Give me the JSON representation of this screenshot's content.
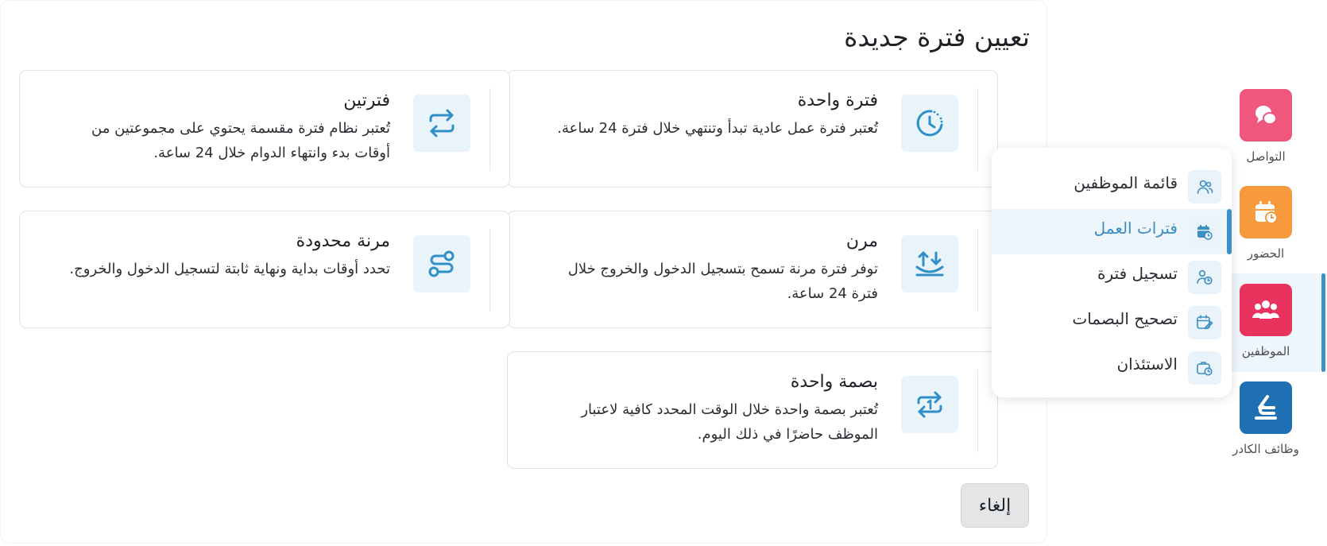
{
  "modal": {
    "title": "تعيين فترة جديدة",
    "cancel_label": "إلغاء",
    "cards": [
      {
        "title": "فترة واحدة",
        "desc": "تُعتبر فترة عمل عادية تبدأ وتنتهي خلال فترة 24 ساعة.",
        "icon": "clock-rotate-icon"
      },
      {
        "title": "فترتين",
        "desc": "تُعتبر نظام فترة مقسمة يحتوي على مجموعتين من أوقات بدء وانتهاء الدوام خلال 24 ساعة.",
        "icon": "repeat-arrows-icon"
      },
      {
        "title": "مرن",
        "desc": "توفر فترة مرنة تسمح بتسجيل الدخول والخروج خلال فترة 24 ساعة.",
        "icon": "flexible-arrows-icon"
      },
      {
        "title": "مرنة محدودة",
        "desc": "تحدد أوقات بداية ونهاية ثابتة لتسجيل الدخول والخروج.",
        "icon": "route-icon"
      },
      {
        "title": "بصمة واحدة",
        "desc": "تُعتبر بصمة واحدة خلال الوقت المحدد كافية لاعتبار الموظف حاضرًا في ذلك اليوم.",
        "icon": "repeat-once-icon"
      }
    ]
  },
  "rail": {
    "items": [
      {
        "label": "التواصل",
        "color": "#f0577c",
        "icon": "chat-bubbles-icon"
      },
      {
        "label": "الحضور",
        "color": "#f79a3e",
        "icon": "calendar-clock-icon"
      },
      {
        "label": "الموظفين",
        "color": "#e8335f",
        "icon": "users-icon"
      },
      {
        "label": "وظائف الكادر",
        "color": "#1f6fb3",
        "icon": "logo-icon"
      }
    ],
    "active_index": 2
  },
  "flyout": {
    "items": [
      {
        "label": "قائمة الموظفين",
        "icon": "users-outline-icon"
      },
      {
        "label": "فترات العمل",
        "icon": "calendar-clock-icon"
      },
      {
        "label": "تسجيل فترة",
        "icon": "user-clock-icon"
      },
      {
        "label": "تصحيح البصمات",
        "icon": "calendar-edit-icon"
      },
      {
        "label": "الاستئذان",
        "icon": "briefcase-clock-icon"
      }
    ],
    "active_index": 1
  },
  "colors": {
    "accent": "#3d91c4",
    "icon_blue": "#2f8fc7",
    "icon_bg": "#e8f3fa"
  }
}
